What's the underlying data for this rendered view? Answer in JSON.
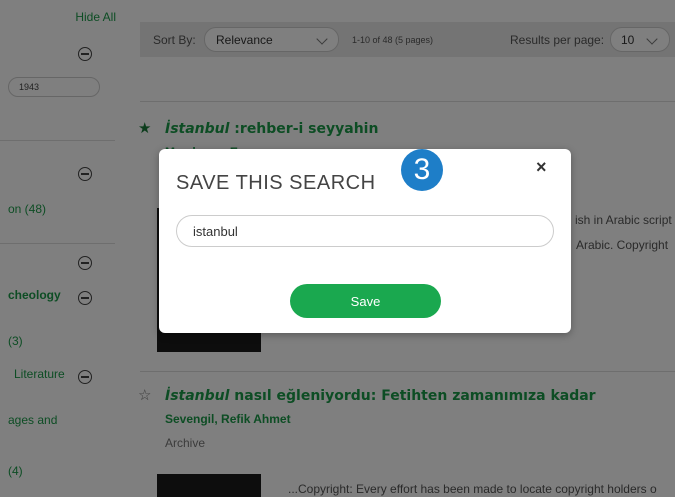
{
  "sidebar": {
    "hide_all": "Hide All",
    "year_value": "1943",
    "facets": [
      {
        "label": "on (48)"
      },
      {
        "label": "cheology"
      },
      {
        "label": "(3)"
      },
      {
        "label": "Literature"
      },
      {
        "label": "ages and"
      },
      {
        "label": "(4)"
      }
    ]
  },
  "sortbar": {
    "sort_label": "Sort By:",
    "sort_value": "Relevance",
    "range_text": "1-10 of 48 (5 pages)",
    "per_page_label": "Results per page:",
    "per_page_value": "10"
  },
  "results": [
    {
      "title_italic": "İstanbul",
      "title_rest": " :rehber-i seyyahin",
      "author": "Membouw, E.",
      "desc1": "ish in Arabic script",
      "desc2": "Arabic. Copyright"
    },
    {
      "title_italic": "İstanbul",
      "title_rest": " nasıl eğleniyordu: Fetihten zamanımıza kadar",
      "author": "Sevengil, Refik Ahmet",
      "format": "Archive",
      "desc1": "...Copyright: Every effort has been made to locate copyright holders o"
    }
  ],
  "modal": {
    "title": "SAVE THIS SEARCH",
    "step_number": "3",
    "close_label": "×",
    "search_name_value": "istanbul",
    "save_label": "Save"
  }
}
